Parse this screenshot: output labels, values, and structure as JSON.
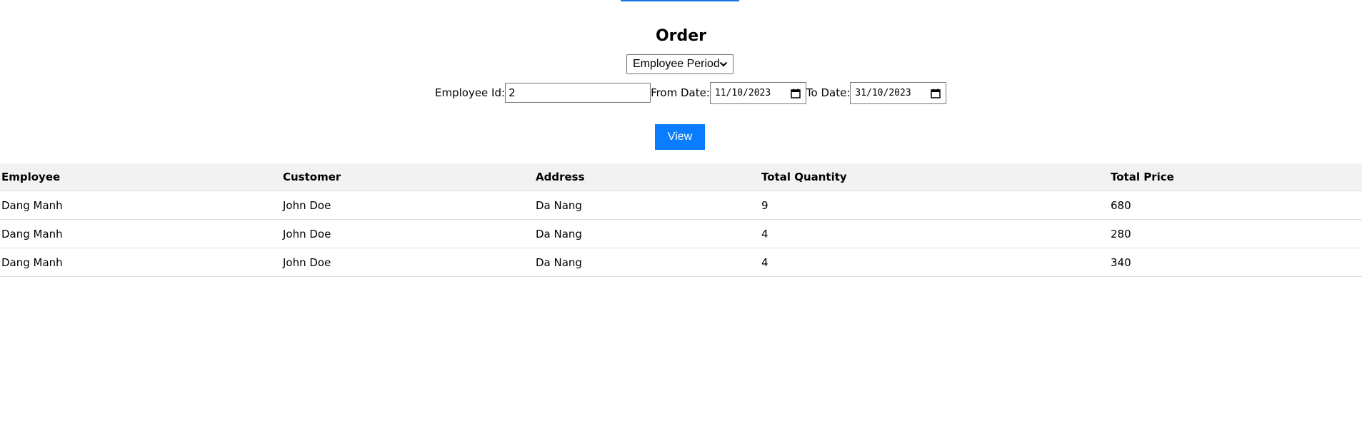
{
  "page": {
    "title": "Order",
    "accent_color": "#0a7cff"
  },
  "filters": {
    "report_type": {
      "selected": "Employee Period",
      "icon": "chevron-down-icon"
    },
    "employee_id_label": "Employee Id:",
    "employee_id_value": "2",
    "from_date_label": "From Date:",
    "from_date_value": "11/10/2023",
    "to_date_label": "To Date:",
    "to_date_value": "31/10/2023",
    "date_icon": "calendar-icon"
  },
  "actions": {
    "view_label": "View"
  },
  "table": {
    "headers": [
      "Employee",
      "Customer",
      "Address",
      "Total Quantity",
      "Total Price"
    ],
    "rows": [
      [
        "Dang Manh",
        "John Doe",
        "Da Nang",
        "9",
        "680"
      ],
      [
        "Dang Manh",
        "John Doe",
        "Da Nang",
        "4",
        "280"
      ],
      [
        "Dang Manh",
        "John Doe",
        "Da Nang",
        "4",
        "340"
      ]
    ]
  }
}
